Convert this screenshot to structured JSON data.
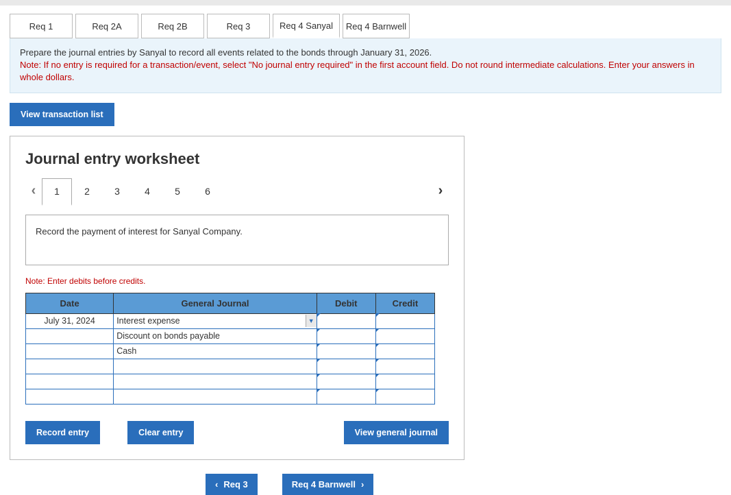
{
  "reqTabs": {
    "items": [
      {
        "label": "Req 1"
      },
      {
        "label": "Req 2A"
      },
      {
        "label": "Req 2B"
      },
      {
        "label": "Req 3"
      },
      {
        "label": "Req 4 Sanyal"
      },
      {
        "label": "Req 4 Barnwell"
      }
    ],
    "activeIndex": 4
  },
  "instruction": {
    "main": "Prepare the journal entries by Sanyal to record all events related to the bonds through January 31, 2026.",
    "note": "Note: If no entry is required for a transaction/event, select \"No journal entry required\" in the first account field. Do not round intermediate calculations. Enter your answers in whole dollars."
  },
  "viewTransBtn": "View transaction list",
  "worksheet": {
    "title": "Journal entry worksheet",
    "steps": [
      "1",
      "2",
      "3",
      "4",
      "5",
      "6"
    ],
    "activeStep": 0,
    "desc": "Record the payment of interest for Sanyal Company.",
    "debitsNote": "Note: Enter debits before credits.",
    "headers": {
      "date": "Date",
      "gj": "General Journal",
      "debit": "Debit",
      "credit": "Credit"
    },
    "rows": [
      {
        "date": "July 31, 2024",
        "gj": "Interest expense",
        "debit": "",
        "credit": "",
        "showDD": true
      },
      {
        "date": "",
        "gj": "Discount on bonds payable",
        "debit": "",
        "credit": ""
      },
      {
        "date": "",
        "gj": "Cash",
        "debit": "",
        "credit": ""
      },
      {
        "date": "",
        "gj": "",
        "debit": "",
        "credit": ""
      },
      {
        "date": "",
        "gj": "",
        "debit": "",
        "credit": ""
      },
      {
        "date": "",
        "gj": "",
        "debit": "",
        "credit": ""
      }
    ],
    "buttons": {
      "record": "Record entry",
      "clear": "Clear entry",
      "view": "View general journal"
    }
  },
  "footerNav": {
    "prev": "Req 3",
    "next": "Req 4 Barnwell"
  }
}
